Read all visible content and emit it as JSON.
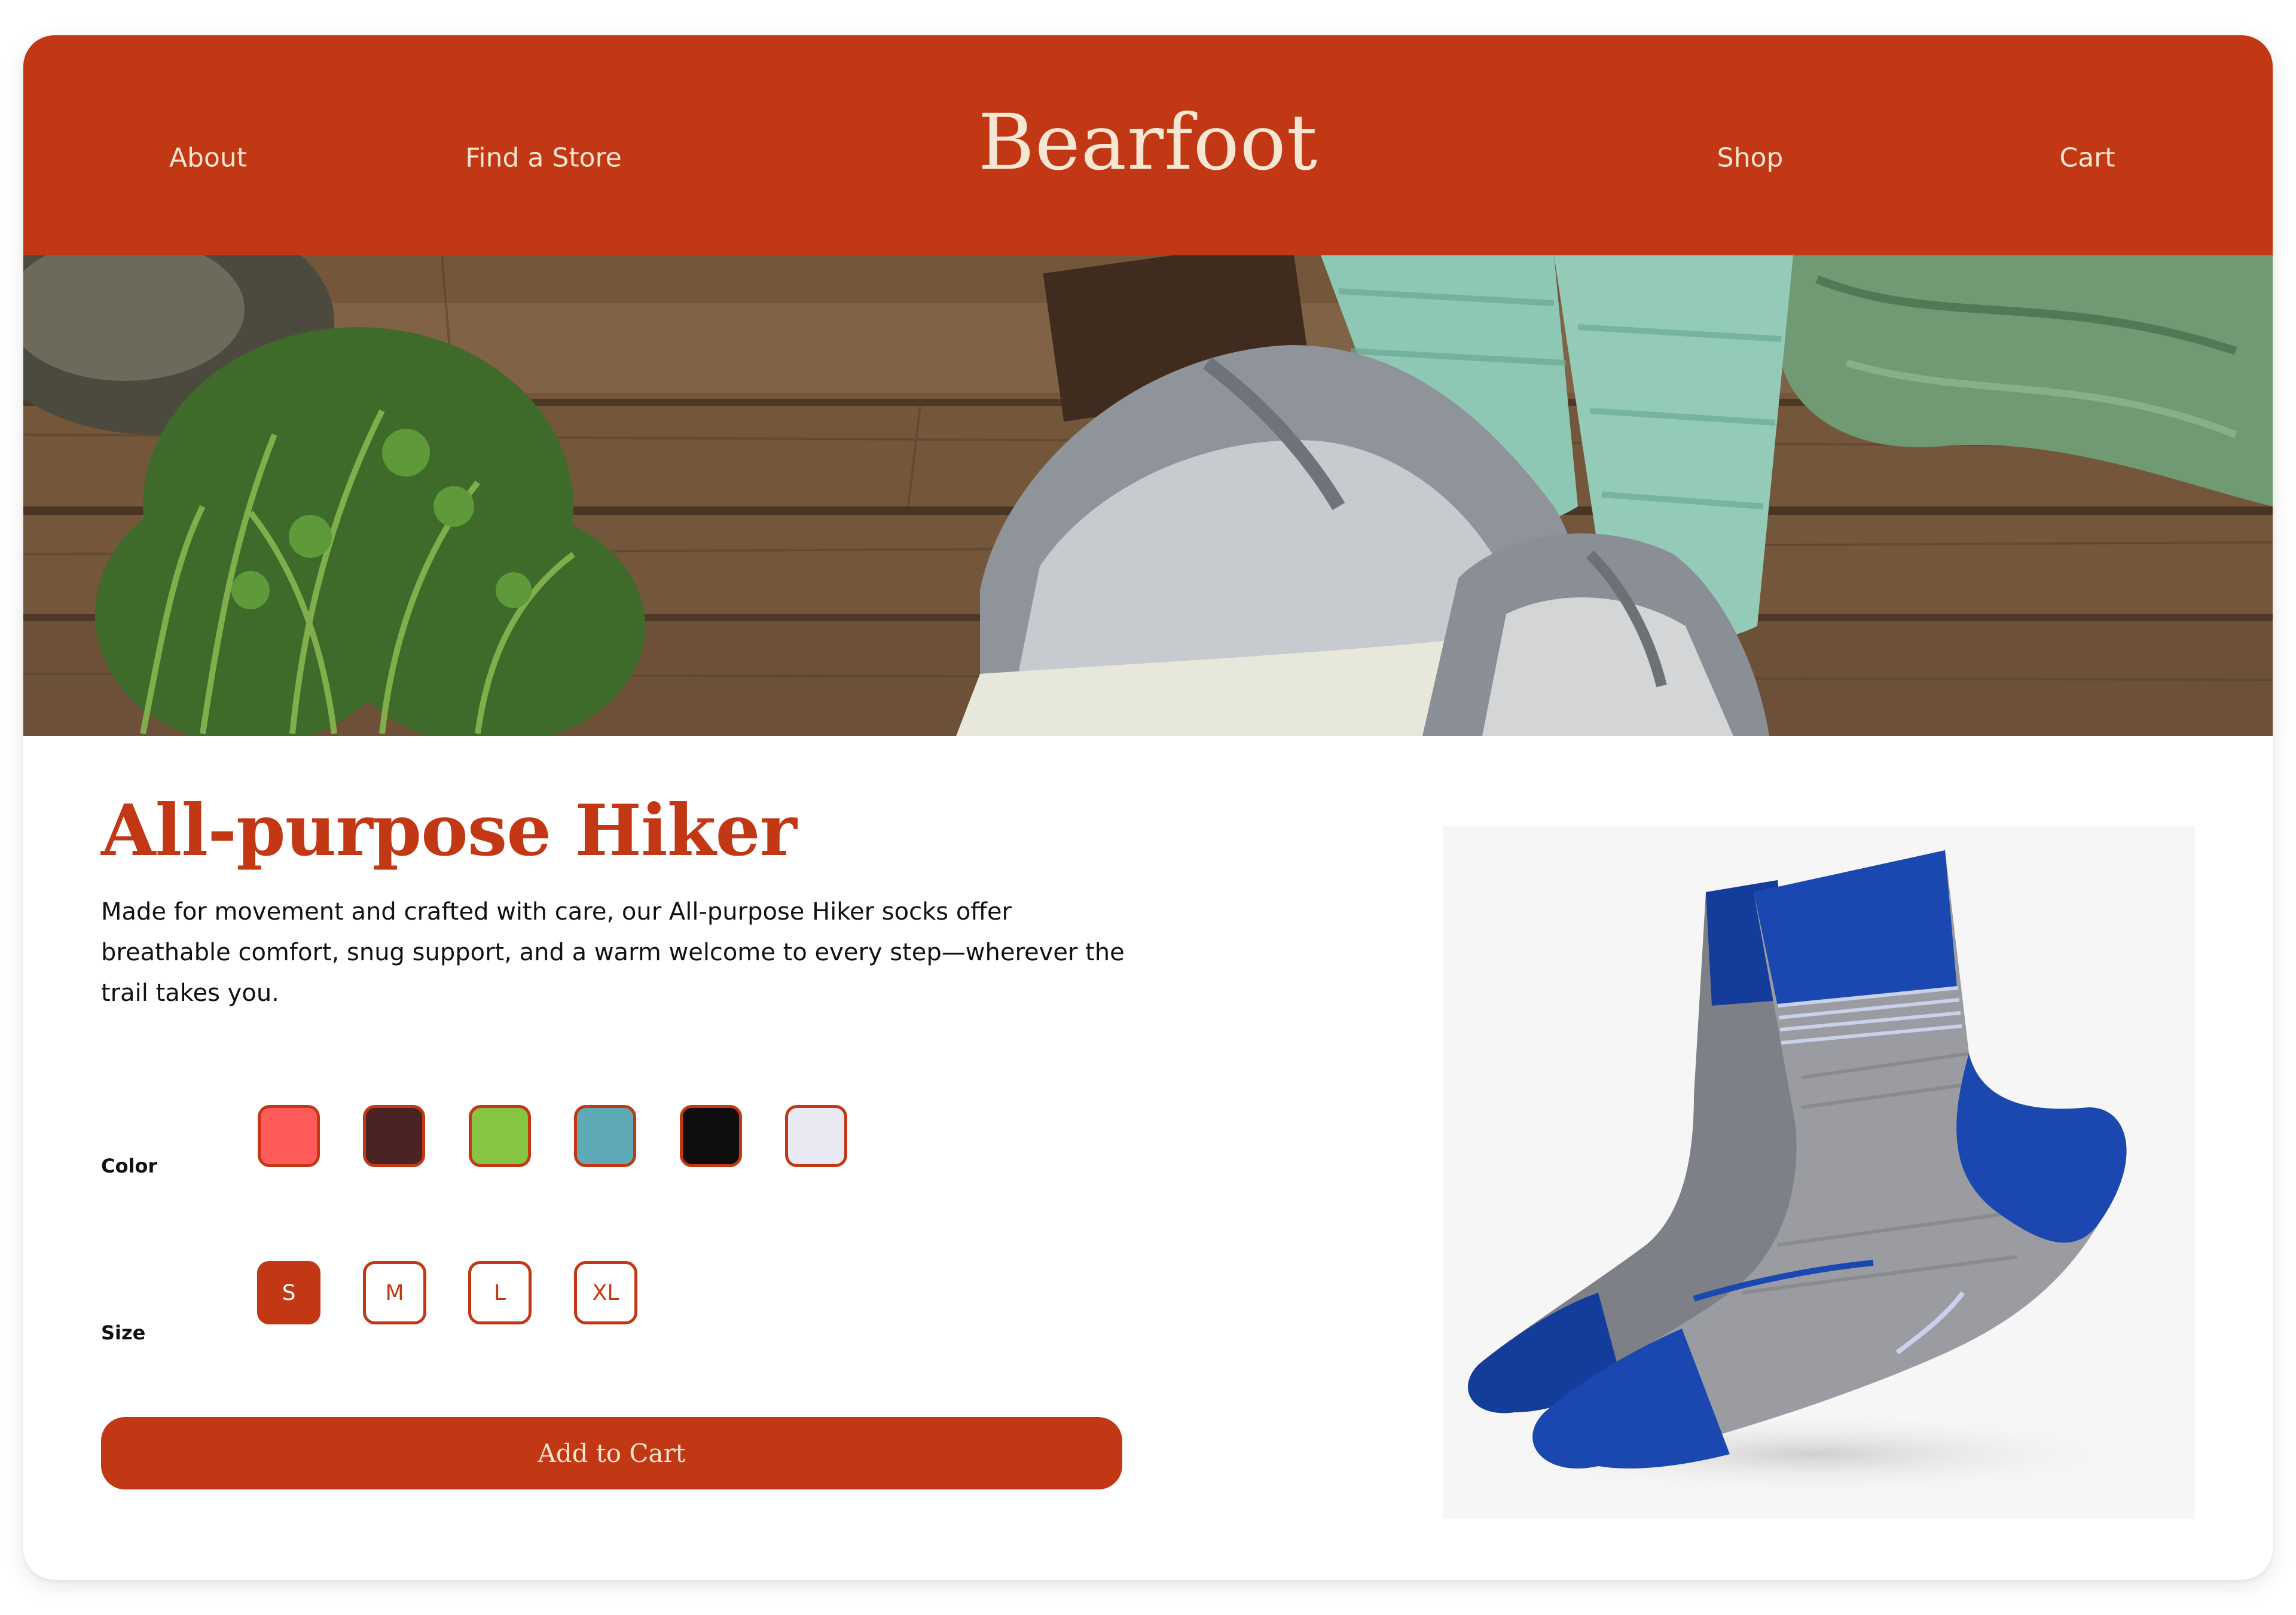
{
  "header": {
    "nav_left": [
      "About",
      "Find a Store"
    ],
    "brand": "Bearfoot",
    "nav_right": [
      "Shop",
      "Cart"
    ]
  },
  "product": {
    "title": "All-purpose Hiker",
    "description": "Made for movement and crafted with care, our All-purpose Hiker socks offer breathable comfort, snug support, and a warm welcome to every step—wherever the trail takes you.",
    "color_label": "Color",
    "colors": [
      "#FF5A5A",
      "#4A2424",
      "#86C542",
      "#5EA9B6",
      "#0F0D0D",
      "#E8E9F2"
    ],
    "size_label": "Size",
    "sizes": [
      "S",
      "M",
      "L",
      "XL"
    ],
    "selected_size": "S",
    "add_to_cart": "Add to Cart"
  },
  "theme": {
    "brand_color": "#C23714",
    "cream": "#F6E6D2"
  }
}
